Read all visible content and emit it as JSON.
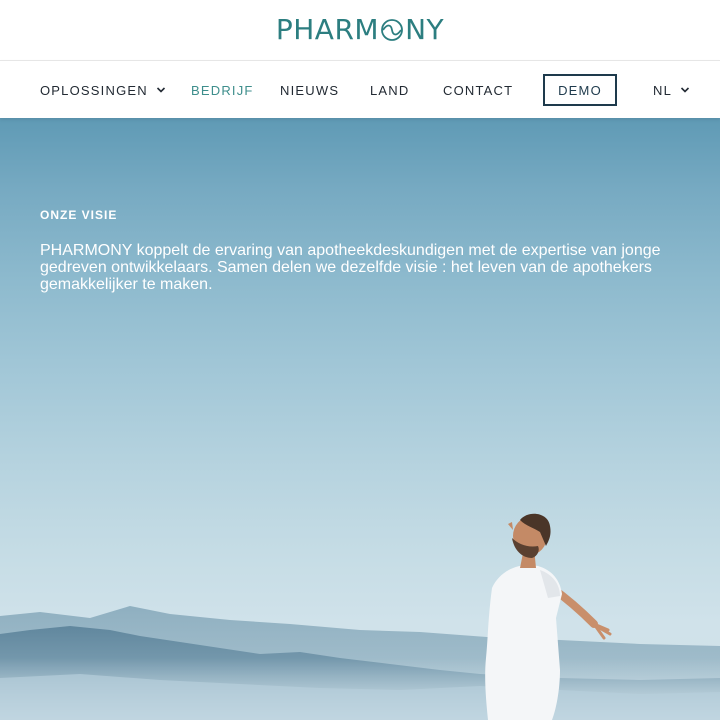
{
  "brand": {
    "logo_text_before": "PHARM",
    "logo_text_after": "NY",
    "logo_mark": "leaf-circle-o",
    "color": "#2c7e80"
  },
  "nav": {
    "items": [
      {
        "label": "OPLOSSINGEN",
        "dropdown": true
      },
      {
        "label": "BEDRIJF",
        "active": true
      },
      {
        "label": "NIEUWS"
      },
      {
        "label": "LAND"
      },
      {
        "label": "CONTACT"
      }
    ],
    "demo_label": "DEMO",
    "language": "NL",
    "active_color": "#3e8e8c"
  },
  "hero": {
    "eyebrow": "ONZE VISIE",
    "text": "PHARMONY koppelt de ervaring van apotheekdeskundigen met de expertise van jonge gedreven ontwikkelaars. Samen delen we dezelfde visie : het leven van de apothekers gemakkelijker te maken.",
    "image": "man-with-open-arms-above-clouds"
  }
}
